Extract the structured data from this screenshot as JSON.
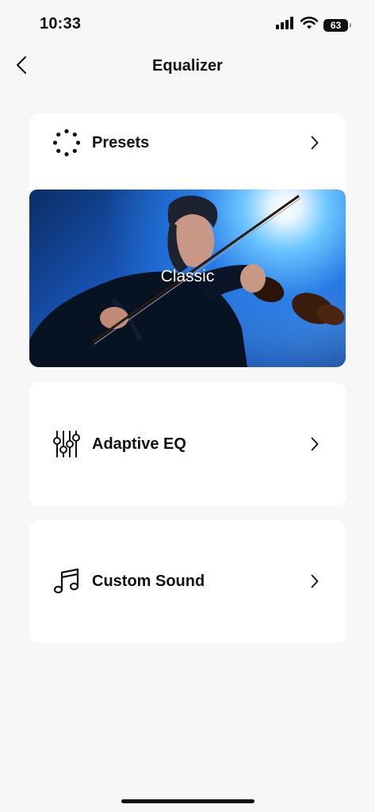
{
  "status_bar": {
    "time": "10:33",
    "battery": "63"
  },
  "header": {
    "title": "Equalizer",
    "back_icon": "chevron-left-icon"
  },
  "presets": {
    "label": "Presets",
    "icon": "dotted-circle-icon",
    "current_preset": "Classic"
  },
  "adaptive_eq": {
    "label": "Adaptive EQ",
    "icon": "sliders-icon"
  },
  "custom_sound": {
    "label": "Custom Sound",
    "icon": "music-note-icon"
  },
  "colors": {
    "background": "#f7f7f7",
    "card": "#ffffff",
    "text": "#111111",
    "image_blue": "#1c5fc9"
  }
}
